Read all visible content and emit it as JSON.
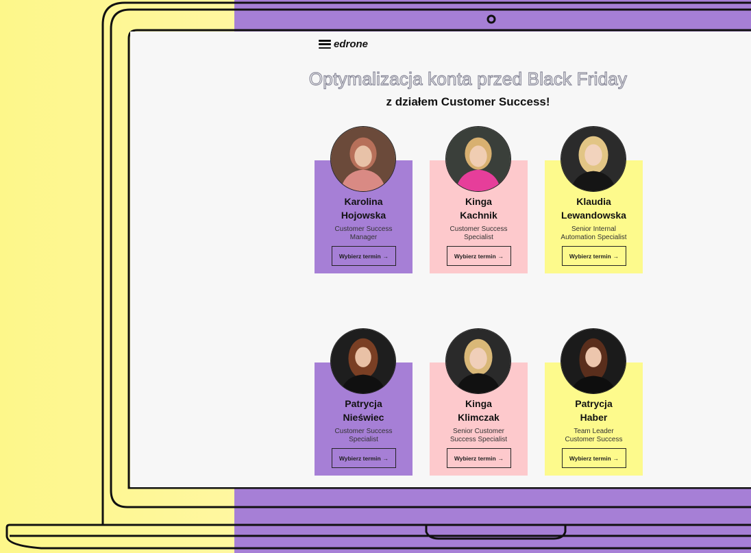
{
  "colors": {
    "left_bg": "#fdf78a",
    "right_bg": "#a67fd6",
    "screen_bg": "#f7f7f7",
    "purple": "#a67fd6",
    "pink": "#fdc9cc",
    "yellow": "#fdfa8c"
  },
  "header": {
    "logo_text": "edrone",
    "menu_icon": "hamburger-icon"
  },
  "page": {
    "title": "Optymalizacja konta przed Black Friday",
    "subtitle": "z działem Customer Success!"
  },
  "cards": [
    {
      "first": "Karolina",
      "last": "Hojowska",
      "role1": "Customer Success",
      "role2": "Manager",
      "button": "Wybierz termin",
      "color": "purple"
    },
    {
      "first": "Kinga",
      "last": "Kachnik",
      "role1": "Customer Success",
      "role2": "Specialist",
      "button": "Wybierz termin",
      "color": "pink"
    },
    {
      "first": "Klaudia",
      "last": "Lewandowska",
      "role1": "Senior Internal",
      "role2": "Automation Specialist",
      "button": "Wybierz termin",
      "color": "yellow"
    },
    {
      "first": "Patrycja",
      "last": "Nieświec",
      "role1": "Customer Success",
      "role2": "Specialist",
      "button": "Wybierz termin",
      "color": "purple"
    },
    {
      "first": "Kinga",
      "last": "Klimczak",
      "role1": "Senior Customer",
      "role2": "Success Specialist",
      "button": "Wybierz termin",
      "color": "pink"
    },
    {
      "first": "Patrycja",
      "last": "Haber",
      "role1": "Team Leader",
      "role2": "Customer Success",
      "button": "Wybierz termin",
      "color": "yellow"
    }
  ]
}
